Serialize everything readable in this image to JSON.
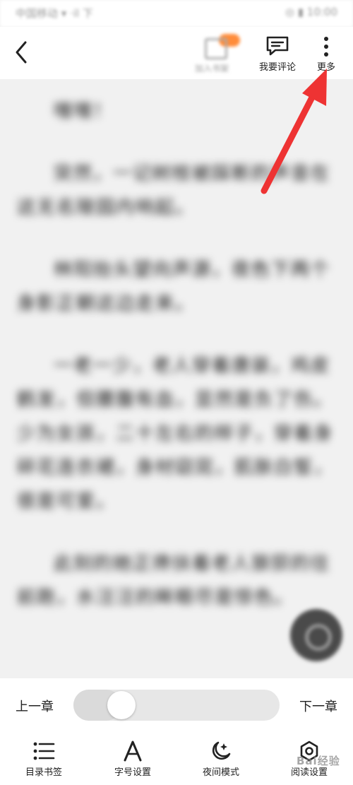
{
  "status_bar": {
    "left_text": "中国移动 ▾ ·il 下",
    "right_text": "◎ ▮ 10:00"
  },
  "top_bar": {
    "shelf_label": "加入书架",
    "comment_label": "我要评论",
    "more_label": "更多"
  },
  "reader": {
    "paragraphs": [
      "嘿嘿！",
      "突然，一记树枝被踩断的声音在这无名陵园内响起。",
      "林阳抬头望向声源，夜色下两个身影正朝这边走来。",
      "一老一少，老人穿着唐装，鸡皮鹤发，但腰腹有血，显然是负了伤。少为女孩，二十左右的样子，穿着身碎花连衣裙，身材窈窕，肌肤白皙，很是可爱。",
      "此刻的她正搀扶着老人狼狈的往前跑，水汪汪的眸眼尽是惊色。"
    ]
  },
  "chapter_bar": {
    "prev_label": "上一章",
    "next_label": "下一章",
    "progress": 0.17
  },
  "bottom_nav": {
    "items": [
      {
        "label": "目录书签",
        "icon": "list-icon"
      },
      {
        "label": "字号设置",
        "icon": "font-size-icon"
      },
      {
        "label": "夜间模式",
        "icon": "night-mode-icon"
      },
      {
        "label": "阅读设置",
        "icon": "reading-settings-icon"
      }
    ]
  },
  "watermark": {
    "text": "Bai经验"
  },
  "colors": {
    "annotation_arrow": "#ee3333",
    "badge": "#ff8c3a"
  }
}
